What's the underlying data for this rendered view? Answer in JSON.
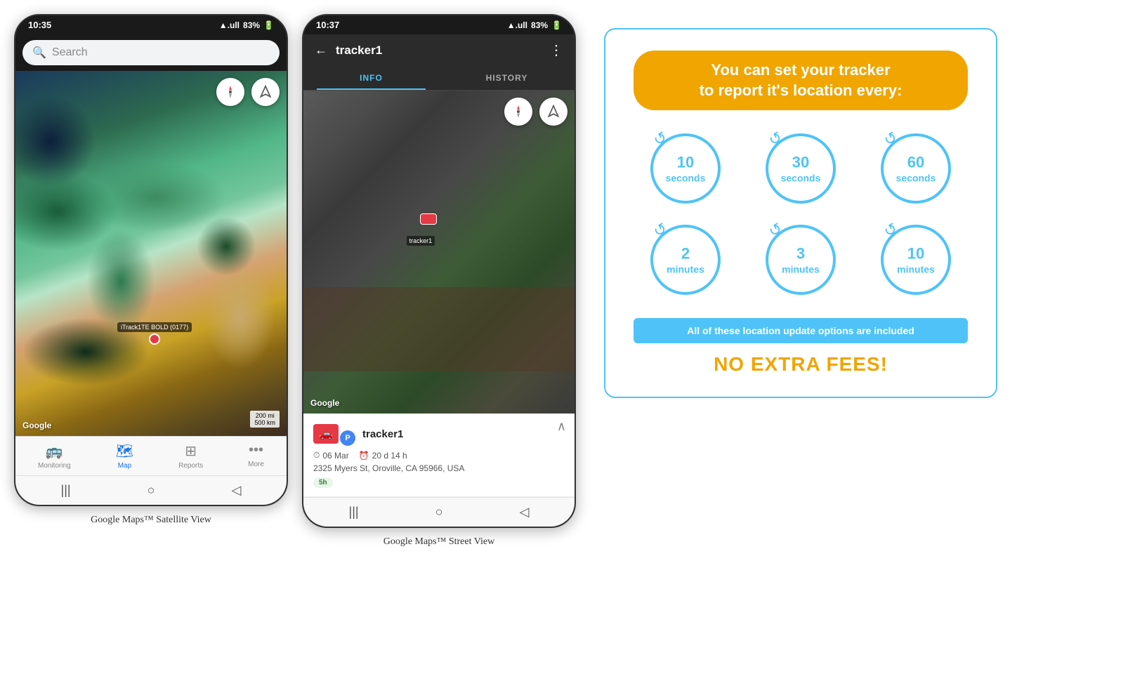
{
  "page": {
    "bg": "#ffffff"
  },
  "phone1": {
    "status_time": "10:35",
    "status_signal": "▲.ull",
    "status_battery": "83%",
    "search_placeholder": "Search",
    "nav_items": [
      {
        "label": "Monitoring",
        "icon": "🚌",
        "active": false
      },
      {
        "label": "Map",
        "icon": "🗺",
        "active": true
      },
      {
        "label": "Reports",
        "icon": "⊞",
        "active": false
      },
      {
        "label": "More",
        "icon": "•••",
        "active": false
      }
    ],
    "tracker_label": "iTrack1TE BOLD (0177)",
    "map_scale": "200 mi\n500 km",
    "google_label": "Google",
    "caption": "Google Maps™ Satellite View"
  },
  "phone2": {
    "status_time": "10:37",
    "status_battery": "83%",
    "back_label": "←",
    "tracker_title": "tracker1",
    "more_icon": "⋮",
    "tab_info": "INFO",
    "tab_history": "HISTORY",
    "google_label": "Google",
    "tracker_name": "tracker1",
    "date": "06 Mar",
    "duration": "20 d 14 h",
    "address": "2325 Myers St, Oroville, CA 95966, USA",
    "time_badge": "5h",
    "caption": "Google Maps™ Street View"
  },
  "info_card": {
    "headline_line1": "You can set your tracker",
    "headline_line2": "to report it's location every:",
    "circles": [
      {
        "value": "10",
        "unit": "seconds"
      },
      {
        "value": "30",
        "unit": "seconds"
      },
      {
        "value": "60",
        "unit": "seconds"
      },
      {
        "value": "2",
        "unit": "minutes"
      },
      {
        "value": "3",
        "unit": "minutes"
      },
      {
        "value": "10",
        "unit": "minutes"
      }
    ],
    "no_fees_text": "All of these location update options are included",
    "no_extra_fees": "NO EXTRA FEES!"
  }
}
